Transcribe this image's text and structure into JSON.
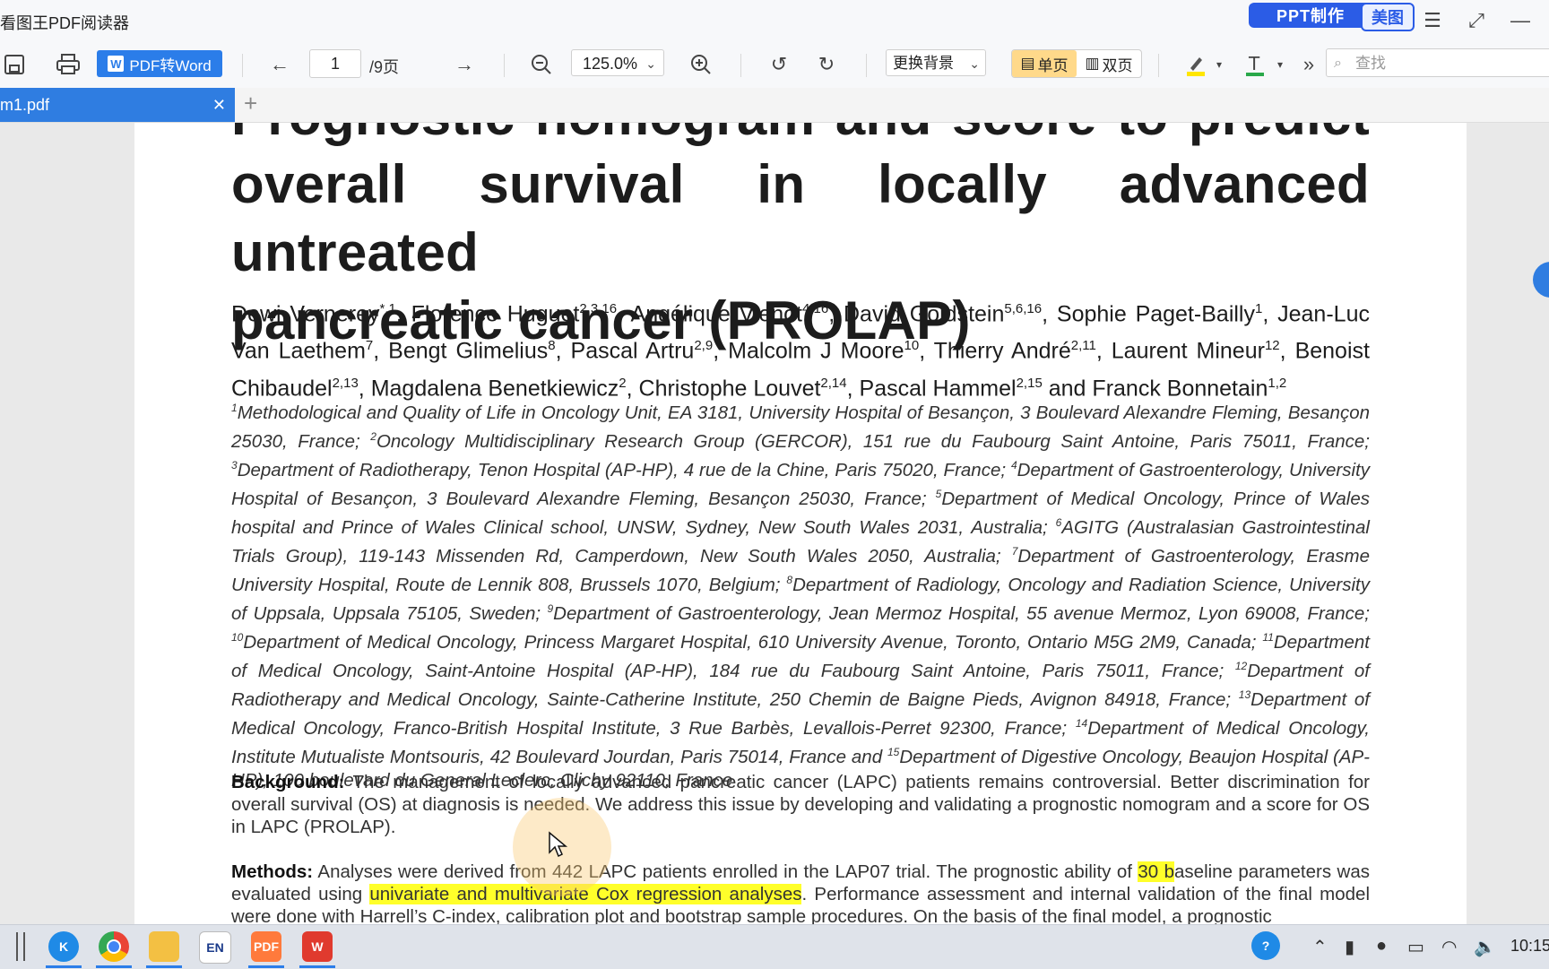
{
  "app": {
    "title": "看图王PDF阅读器",
    "ppt_label": "PPT制作",
    "meitu_label": "美图"
  },
  "toolbar": {
    "pdf2word_label": "PDF转Word",
    "current_page": "1",
    "total_pages": "/9页",
    "zoom": "125.0%",
    "background_label": "更换背景",
    "single_page_label": "单页",
    "double_page_label": "双页",
    "search_placeholder": "查找"
  },
  "tabs": [
    {
      "label": "m1.pdf",
      "active": true
    }
  ],
  "document": {
    "title_lines": [
      "Prognostic nomogram and score to predict",
      "overall survival in locally advanced untreated",
      "pancreatic cancer (PROLAP)"
    ],
    "authors": [
      {
        "name": "Dewi Vernerey",
        "sup": "*,1"
      },
      {
        "name": "Florence Huguet",
        "sup": "2,3,16"
      },
      {
        "name": "Angélique Vienot",
        "sup": "4,16"
      },
      {
        "name": "David Goldstein",
        "sup": "5,6,16"
      },
      {
        "name": "Sophie Paget-Bailly",
        "sup": "1"
      },
      {
        "name": "Jean-Luc Van Laethem",
        "sup": "7"
      },
      {
        "name": "Bengt Glimelius",
        "sup": "8"
      },
      {
        "name": "Pascal Artru",
        "sup": "2,9"
      },
      {
        "name": "Malcolm J Moore",
        "sup": "10"
      },
      {
        "name": "Thierry André",
        "sup": "2,11"
      },
      {
        "name": "Laurent Mineur",
        "sup": "12"
      },
      {
        "name": "Benoist Chibaudel",
        "sup": "2,13"
      },
      {
        "name": "Magdalena Benetkiewicz",
        "sup": "2"
      },
      {
        "name": "Christophe Louvet",
        "sup": "2,14"
      },
      {
        "name": "Pascal Hammel",
        "sup": "2,15"
      },
      {
        "name": "Franck Bonnetain",
        "sup": "1,2"
      }
    ],
    "authors_and": "and",
    "affiliations": [
      {
        "n": "1",
        "text": "Methodological and Quality of Life in Oncology Unit, EA 3181, University Hospital of Besançon, 3 Boulevard Alexandre Fleming, Besançon 25030, France;"
      },
      {
        "n": "2",
        "text": "Oncology Multidisciplinary Research Group (GERCOR), 151 rue du Faubourg Saint Antoine, Paris 75011, France;"
      },
      {
        "n": "3",
        "text": "Department of Radiotherapy, Tenon Hospital (AP-HP), 4 rue de la Chine, Paris 75020, France;"
      },
      {
        "n": "4",
        "text": "Department of Gastroenterology, University Hospital of Besançon, 3 Boulevard Alexandre Fleming, Besançon 25030, France;"
      },
      {
        "n": "5",
        "text": "Department of Medical Oncology, Prince of Wales hospital and Prince of Wales Clinical school, UNSW, Sydney, New South Wales 2031, Australia;"
      },
      {
        "n": "6",
        "text": "AGITG (Australasian Gastrointestinal Trials Group), 119-143 Missenden Rd, Camperdown, New South Wales 2050, Australia;"
      },
      {
        "n": "7",
        "text": "Department of Gastroenterology, Erasme University Hospital, Route de Lennik 808, Brussels 1070, Belgium;"
      },
      {
        "n": "8",
        "text": "Department of Radiology, Oncology and Radiation Science, University of Uppsala, Uppsala 75105, Sweden;"
      },
      {
        "n": "9",
        "text": "Department of Gastroenterology, Jean Mermoz Hospital, 55 avenue Mermoz, Lyon 69008, France;"
      },
      {
        "n": "10",
        "text": "Department of Medical Oncology, Princess Margaret Hospital, 610 University Avenue, Toronto, Ontario M5G 2M9, Canada;"
      },
      {
        "n": "11",
        "text": "Department of Medical Oncology, Saint-Antoine Hospital (AP-HP), 184 rue du Faubourg Saint Antoine, Paris 75011, France;"
      },
      {
        "n": "12",
        "text": "Department of Radiotherapy and Medical Oncology, Sainte-Catherine Institute, 250 Chemin de Baigne Pieds, Avignon 84918, France;"
      },
      {
        "n": "13",
        "text": "Department of Medical Oncology, Franco-British Hospital Institute, 3 Rue Barbès, Levallois-Perret 92300, France;"
      },
      {
        "n": "14",
        "text": "Department of Medical Oncology, Institute Mutualiste Montsouris, 42 Boulevard Jourdan, Paris 75014, France and"
      },
      {
        "n": "15",
        "text": "Department of Digestive Oncology, Beaujon Hospital (AP-HP), 100 boulevard du General Leclerc, Clichy 92110, France"
      }
    ],
    "background": {
      "label": "Background:",
      "text": "The management of locally advanced pancreatic cancer (LAPC) patients remains controversial. Better discrimination for overall survival (OS) at diagnosis is needed. We address this issue by developing and validating a prognostic nomogram and a score for OS in LAPC (PROLAP)."
    },
    "methods": {
      "label": "Methods:",
      "text_1": "Analyses were derived from 442 LAPC patients enrolled in the LAP07 trial. The prognostic ability of ",
      "highlight_1": "30 b",
      "text_2": "aseline parameters was evaluated using ",
      "highlight_2": "univariate and multivariate Cox regression analyses",
      "text_3": ". Performance assessment and internal validation of the final model were done with Harrell’s C-index, calibration plot and bootstrap sample procedures. On the basis of the final model, a prognostic"
    }
  },
  "taskbar": {
    "lang": "EN",
    "pdf": "PDF",
    "clock": "10:15"
  }
}
